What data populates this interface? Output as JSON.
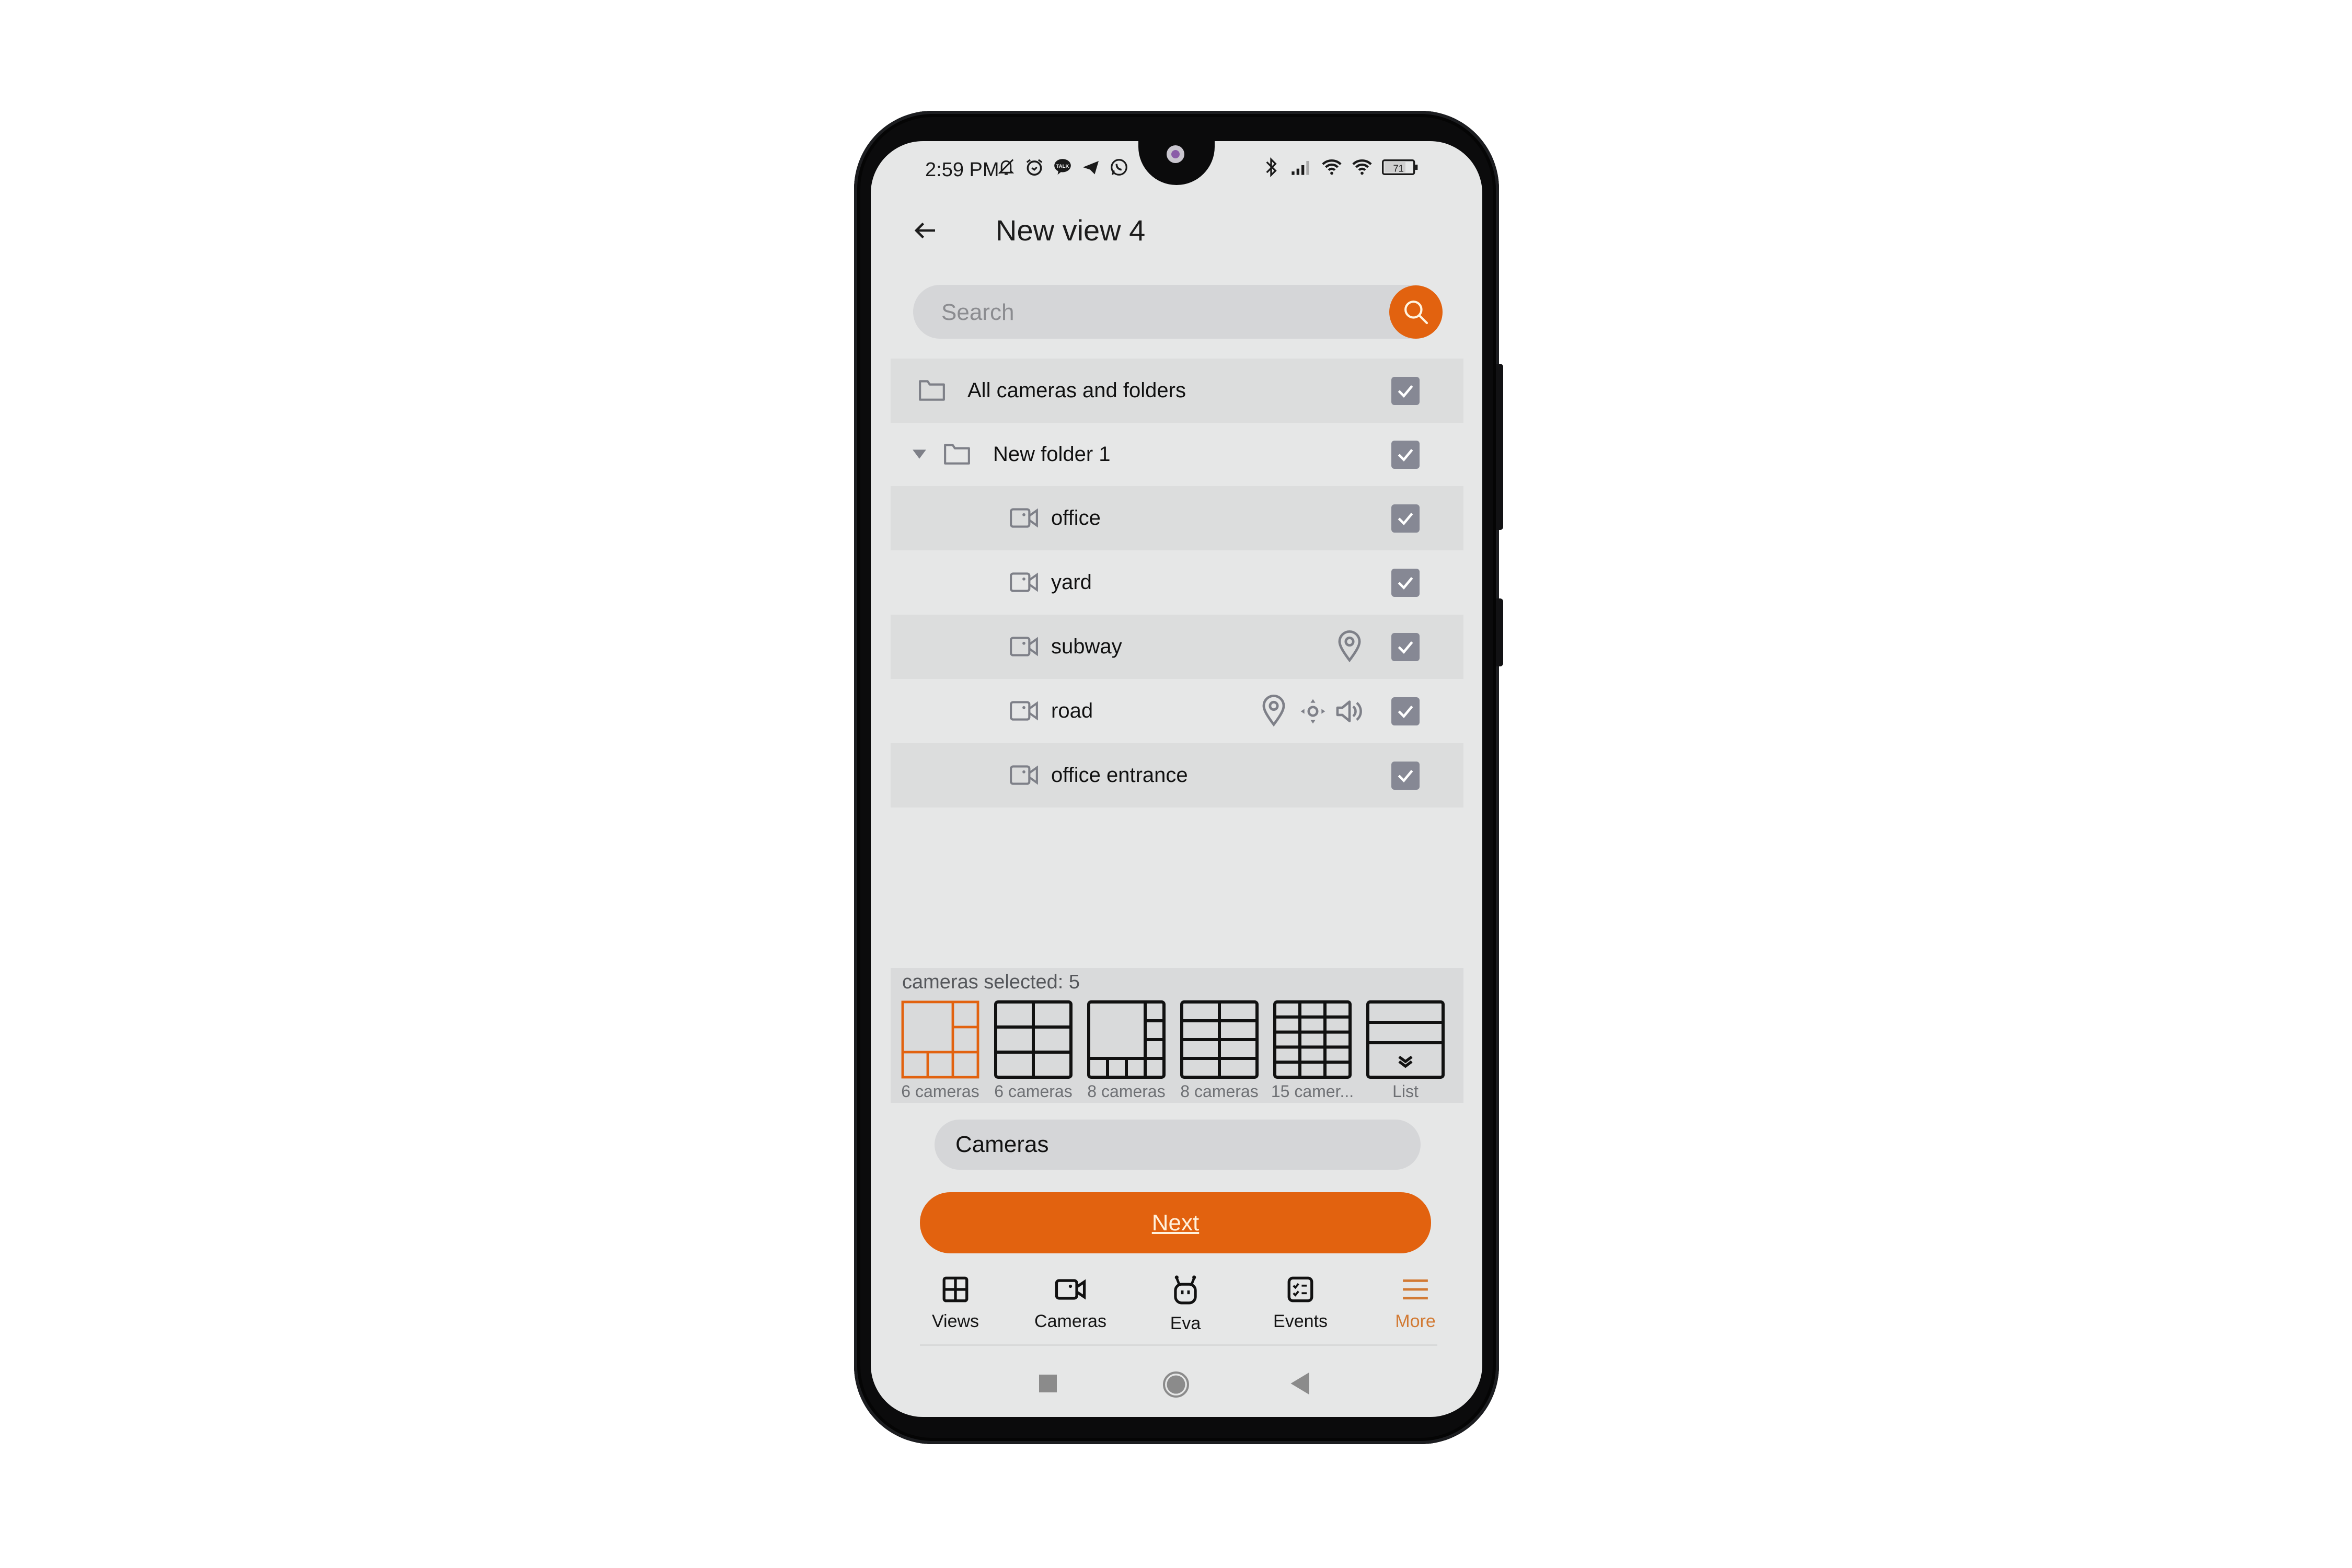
{
  "status_bar": {
    "time": "2:59 PM",
    "left_icons": [
      "bell-off-icon",
      "alarm-icon",
      "talk-icon",
      "telegram-icon",
      "whatsapp-icon"
    ],
    "right_icons": [
      "bluetooth-icon",
      "signal-icon",
      "wifi-icon",
      "wifi-icon"
    ],
    "battery": "71"
  },
  "header": {
    "title": "New view 4",
    "back_icon": "arrow-left-icon"
  },
  "search": {
    "placeholder": "Search",
    "value": ""
  },
  "colors": {
    "accent": "#E2620F",
    "checkbox": "#868894",
    "screen_bg": "#E6E7E7",
    "row_shade": "#DCDDDD"
  },
  "tree": {
    "root": {
      "label": "All cameras and folders",
      "checked": true
    },
    "folder": {
      "label": "New folder 1",
      "expanded": true,
      "checked": true
    },
    "cameras": [
      {
        "label": "office",
        "checked": true,
        "badges": []
      },
      {
        "label": "yard",
        "checked": true,
        "badges": []
      },
      {
        "label": "subway",
        "checked": true,
        "badges": [
          "location-icon"
        ]
      },
      {
        "label": "road",
        "checked": true,
        "badges": [
          "location-icon",
          "ptz-icon",
          "sound-icon"
        ]
      },
      {
        "label": "office entrance",
        "checked": true,
        "badges": []
      }
    ]
  },
  "selection": {
    "summary": "cameras selected: 5",
    "layouts": [
      {
        "label": "6 cameras",
        "selected": true
      },
      {
        "label": "6 cameras",
        "selected": false
      },
      {
        "label": "8 cameras",
        "selected": false
      },
      {
        "label": "8 cameras",
        "selected": false
      },
      {
        "label": "15 camer...",
        "selected": false
      },
      {
        "label": "List",
        "selected": false
      }
    ]
  },
  "view_name": {
    "value": "Cameras"
  },
  "next_button": {
    "label": "Next"
  },
  "bottom_nav": {
    "items": [
      {
        "label": "Views",
        "icon": "views-grid-icon",
        "active": false
      },
      {
        "label": "Cameras",
        "icon": "camera-icon",
        "active": false
      },
      {
        "label": "Eva",
        "icon": "robot-icon",
        "active": false
      },
      {
        "label": "Events",
        "icon": "events-icon",
        "active": false
      },
      {
        "label": "More",
        "icon": "menu-icon",
        "active": true
      }
    ]
  }
}
